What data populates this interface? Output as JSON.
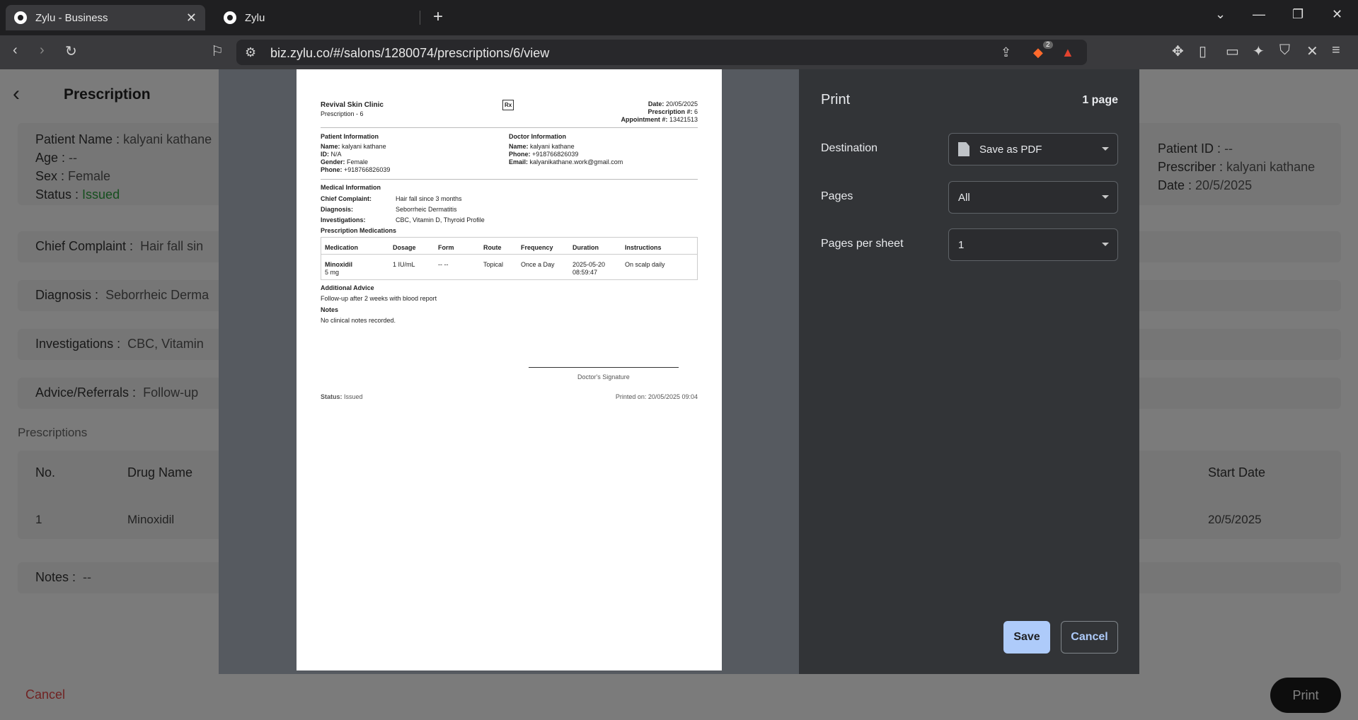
{
  "browser": {
    "tabs": [
      {
        "title": "Zylu - Business",
        "active": true
      },
      {
        "title": "Zylu",
        "active": false
      }
    ],
    "url": "biz.zylu.co/#/salons/1280074/prescriptions/6/view",
    "brave_badge": "2"
  },
  "app": {
    "page_title": "Prescription",
    "patient": {
      "name_label": "Patient Name :",
      "name": "kalyani kathane",
      "age_label": "Age :",
      "age": "--",
      "sex_label": "Sex :",
      "sex": "Female",
      "status_label": "Status :",
      "status": "Issued",
      "id_label": "Patient ID :",
      "id": "--",
      "prescriber_label": "Prescriber :",
      "prescriber": "kalyani kathane",
      "date_label": "Date :",
      "date": "20/5/2025"
    },
    "chief_complaint_label": "Chief Complaint :",
    "chief_complaint": "Hair fall sin",
    "diagnosis_label": "Diagnosis :",
    "diagnosis": "Seborrheic Derma",
    "investigations_label": "Investigations :",
    "investigations": "CBC, Vitamin",
    "advice_label": "Advice/Referrals :",
    "advice": "Follow-up",
    "prescriptions_title": "Prescriptions",
    "table_headers": {
      "no": "No.",
      "drug": "Drug Name",
      "start": "Start Date"
    },
    "rows": [
      {
        "no": "1",
        "drug": "Minoxidil",
        "start": "20/5/2025"
      }
    ],
    "notes_label": "Notes :",
    "notes": "--",
    "cancel_label": "Cancel",
    "print_label": "Print"
  },
  "print_dialog": {
    "title": "Print",
    "page_count": "1 page",
    "destination_label": "Destination",
    "destination": "Save as PDF",
    "pages_label": "Pages",
    "pages": "All",
    "pps_label": "Pages per sheet",
    "pps": "1",
    "save_label": "Save",
    "cancel_label": "Cancel"
  },
  "sheet": {
    "clinic": "Revival Skin Clinic",
    "prescription_sub": "Prescription - 6",
    "rx": "Rx",
    "date_label": "Date:",
    "date": "20/05/2025",
    "presc_no_label": "Prescription #:",
    "presc_no": "6",
    "appt_label": "Appointment #:",
    "appt": "13421513",
    "patient_info_title": "Patient Information",
    "p_name_label": "Name:",
    "p_name": "kalyani kathane",
    "p_id_label": "ID:",
    "p_id": "N/A",
    "p_gender_label": "Gender:",
    "p_gender": "Female",
    "p_phone_label": "Phone:",
    "p_phone": "+918766826039",
    "doctor_info_title": "Doctor Information",
    "d_name_label": "Name:",
    "d_name": "kalyani kathane",
    "d_phone_label": "Phone:",
    "d_phone": "+918766826039",
    "d_email_label": "Email:",
    "d_email": "kalyanikathane.work@gmail.com",
    "medical_info_title": "Medical Information",
    "cc_label": "Chief Complaint:",
    "cc": "Hair fall since 3 months",
    "dx_label": "Diagnosis:",
    "dx": "Seborrheic Dermatitis",
    "inv_label": "Investigations:",
    "inv": "CBC, Vitamin D, Thyroid Profile",
    "meds_title": "Prescription Medications",
    "med_headers": [
      "Medication",
      "Dosage",
      "Form",
      "Route",
      "Frequency",
      "Duration",
      "Instructions"
    ],
    "med_row": {
      "name": "Minoxidil",
      "strength": "5 mg",
      "dosage": "1 IU/mL",
      "form": "-- --",
      "route": "Topical",
      "frequency": "Once a Day",
      "duration1": "2025-05-20",
      "duration2": "08:59:47",
      "instructions": "On scalp daily"
    },
    "advice_title": "Additional Advice",
    "advice": "Follow-up after 2 weeks with blood report",
    "notes_title": "Notes",
    "notes": "No clinical notes recorded.",
    "signature_label": "Doctor's Signature",
    "status_label": "Status:",
    "status": "Issued",
    "printed_on": "Printed on: 20/05/2025 09:04"
  }
}
